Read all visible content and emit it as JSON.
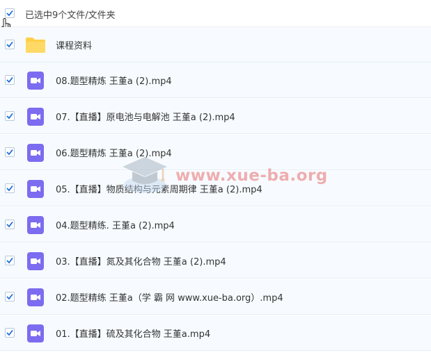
{
  "header": {
    "selection_label": "已选中9个文件/文件夹"
  },
  "colors": {
    "checkbox_check": "#1e6fd9",
    "video_icon": "#7b6cf0",
    "folder_icon": "#ffcf4a",
    "row_background": "#f7fbff"
  },
  "items": [
    {
      "name": "课程资料",
      "type": "folder",
      "icon": "folder-icon",
      "checked": true
    },
    {
      "name": "08.题型精炼 王堇a (2).mp4",
      "type": "video",
      "icon": "video-file-icon",
      "checked": true
    },
    {
      "name": "07.【直播】原电池与电解池 王堇a (2).mp4",
      "type": "video",
      "icon": "video-file-icon",
      "checked": true
    },
    {
      "name": "06.题型精炼 王堇a (2).mp4",
      "type": "video",
      "icon": "video-file-icon",
      "checked": true
    },
    {
      "name": "05.【直播】物质结构与元素周期律 王堇a (2).mp4",
      "type": "video",
      "icon": "video-file-icon",
      "checked": true
    },
    {
      "name": "04.题型精练. 王堇a (2).mp4",
      "type": "video",
      "icon": "video-file-icon",
      "checked": true
    },
    {
      "name": "03.【直播】氮及其化合物 王堇a (2).mp4",
      "type": "video",
      "icon": "video-file-icon",
      "checked": true
    },
    {
      "name": "02.题型精练 王堇a（学 霸 网 www.xue-ba.org）.mp4",
      "type": "video",
      "icon": "video-file-icon",
      "checked": true
    },
    {
      "name": "01.【直播】硫及其化合物 王堇a.mp4",
      "type": "video",
      "icon": "video-file-icon",
      "checked": true
    }
  ],
  "watermark": {
    "text": "www.xue-ba.org",
    "icon": "graduation-cap-icon"
  }
}
